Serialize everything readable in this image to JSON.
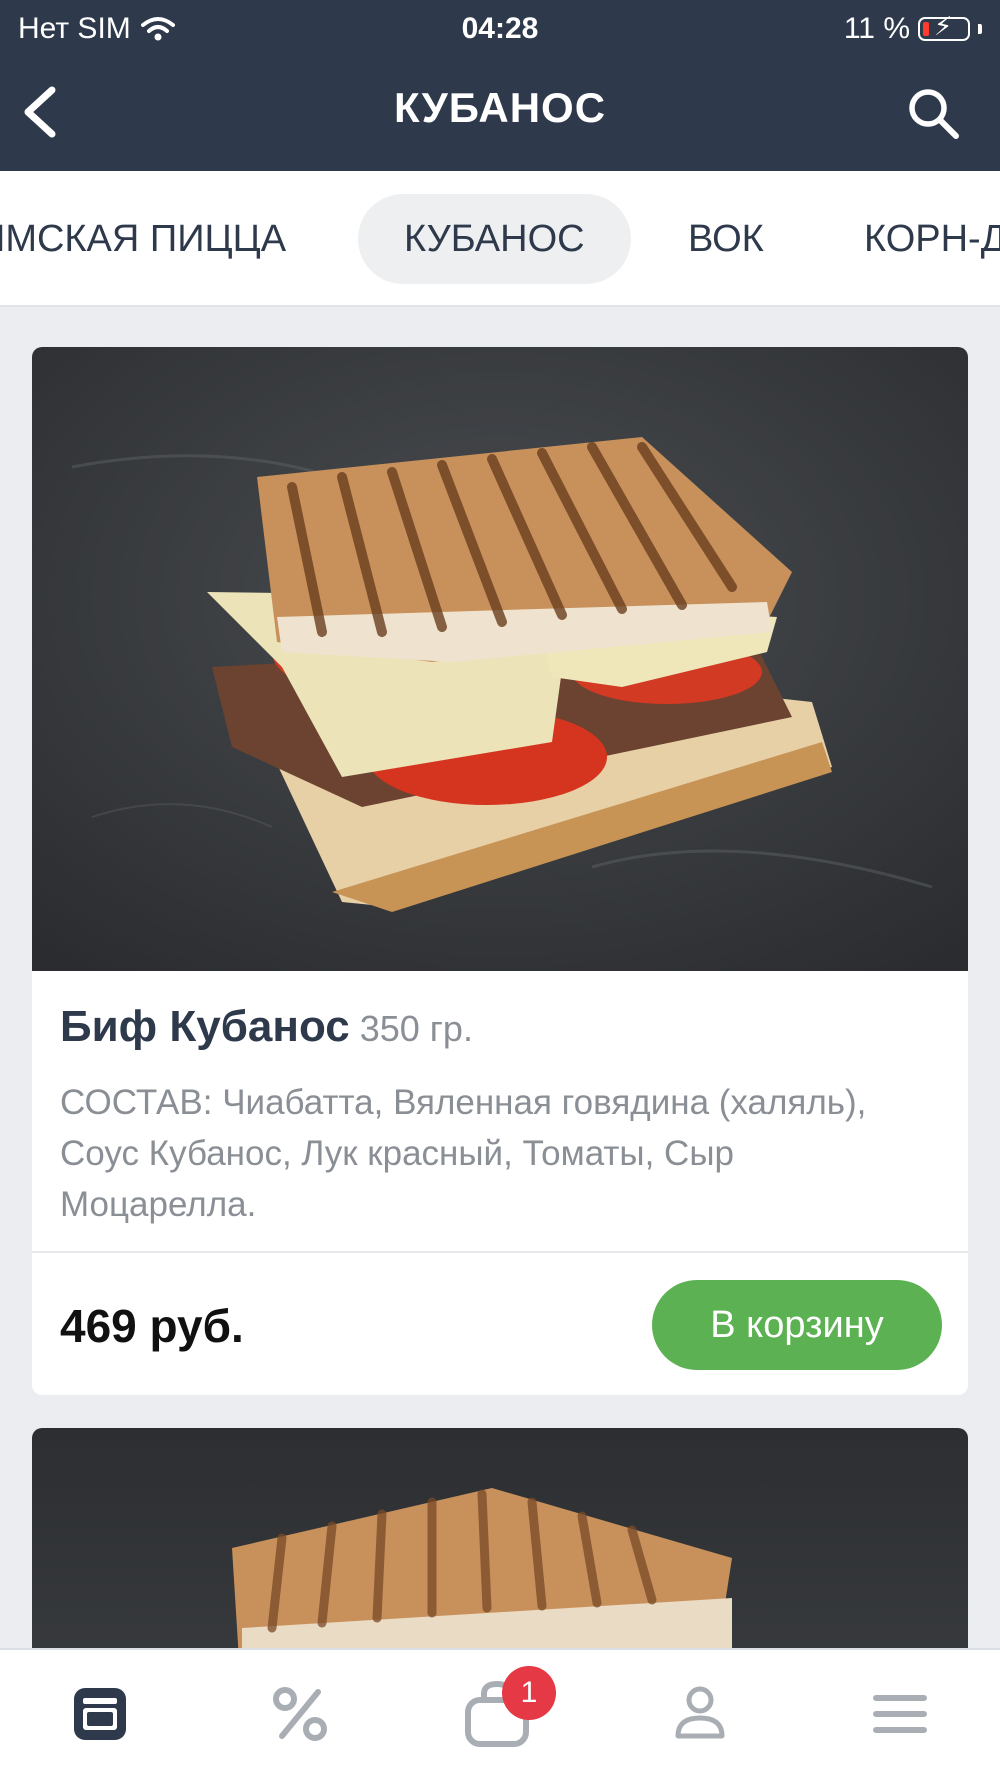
{
  "status_bar": {
    "carrier": "Нет SIM",
    "time": "04:28",
    "battery": "11 %"
  },
  "header": {
    "title": "КУБАНОС",
    "back_icon": "chevron-left-icon",
    "search_icon": "search-icon"
  },
  "categories": [
    {
      "label": "ИМСКАЯ ПИЦЦА",
      "active": false
    },
    {
      "label": "КУБАНОС",
      "active": true
    },
    {
      "label": "ВОК",
      "active": false
    },
    {
      "label": "КОРН-Д",
      "active": false
    }
  ],
  "products": [
    {
      "name": "Биф Кубанос",
      "weight": "350 гр.",
      "description": "СОСТАВ: Чиабатта, Вяленная говядина (халяль), Соус Кубанос, Лук красный, Томаты, Сыр Моцарелла.",
      "price": "469 руб.",
      "cart_button": "В корзину"
    }
  ],
  "tabbar": {
    "items": [
      {
        "icon": "menu-icon",
        "active": true
      },
      {
        "icon": "percent-icon",
        "active": false
      },
      {
        "icon": "cart-icon",
        "active": false
      },
      {
        "icon": "profile-icon",
        "active": false
      },
      {
        "icon": "more-icon",
        "active": false
      }
    ],
    "cart_badge": "1"
  },
  "colors": {
    "header_bg": "#2e3a4b",
    "accent_green": "#5cb152",
    "badge_red": "#e53945",
    "page_bg": "#ebedf0"
  }
}
